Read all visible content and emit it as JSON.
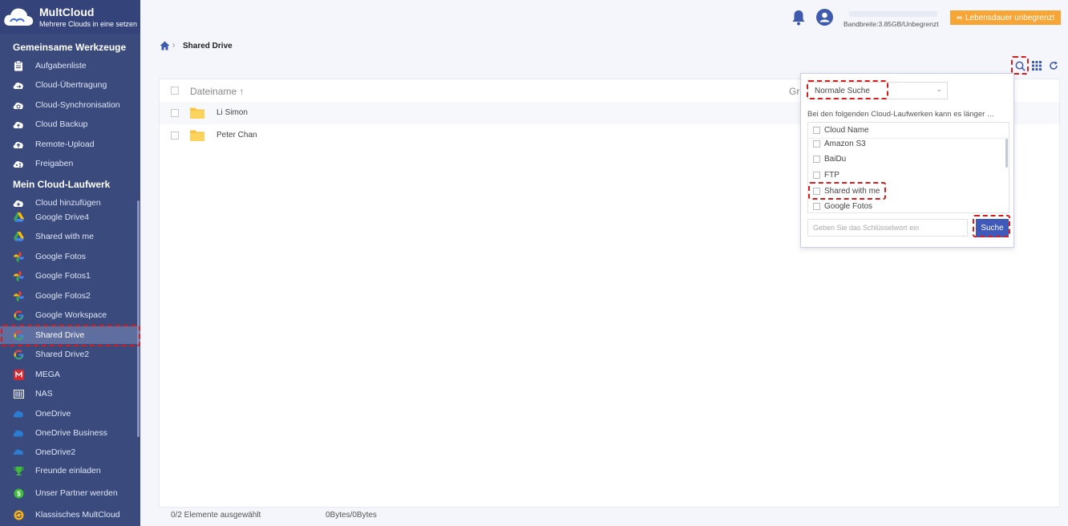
{
  "app": {
    "name": "MultCloud",
    "tagline": "Mehrere Clouds in eine setzen"
  },
  "sidebar": {
    "section_tools": "Gemeinsame Werkzeuge",
    "tools": [
      {
        "label": "Aufgabenliste",
        "icon": "clipboard-icon"
      },
      {
        "label": "Cloud-Übertragung",
        "icon": "cloud-transfer-icon"
      },
      {
        "label": "Cloud-Synchronisation",
        "icon": "cloud-sync-icon"
      },
      {
        "label": "Cloud Backup",
        "icon": "cloud-backup-icon"
      },
      {
        "label": "Remote-Upload",
        "icon": "cloud-upload-icon"
      },
      {
        "label": "Freigaben",
        "icon": "cloud-share-icon"
      }
    ],
    "section_drives": "Mein Cloud-Laufwerk",
    "add_cloud": "Cloud hinzufügen",
    "drives": [
      {
        "label": "Google Drive4",
        "icon": "google-drive-icon"
      },
      {
        "label": "Shared with me",
        "icon": "google-drive-icon"
      },
      {
        "label": "Google Fotos",
        "icon": "google-photos-icon"
      },
      {
        "label": "Google Fotos1",
        "icon": "google-photos-icon"
      },
      {
        "label": "Google Fotos2",
        "icon": "google-photos-icon"
      },
      {
        "label": "Google Workspace",
        "icon": "google-g-icon"
      },
      {
        "label": "Shared Drive",
        "icon": "google-g-icon"
      },
      {
        "label": "Shared Drive2",
        "icon": "google-g-icon"
      },
      {
        "label": "MEGA",
        "icon": "mega-icon"
      },
      {
        "label": "NAS",
        "icon": "nas-icon"
      },
      {
        "label": "OneDrive",
        "icon": "onedrive-icon"
      },
      {
        "label": "OneDrive Business",
        "icon": "onedrive-icon"
      },
      {
        "label": "OneDrive2",
        "icon": "onedrive-icon"
      }
    ],
    "bottom": [
      {
        "label": "Freunde einladen",
        "icon": "trophy-icon"
      },
      {
        "label": "Unser Partner werden",
        "icon": "dollar-icon"
      },
      {
        "label": "Klassisches MultCloud",
        "icon": "classic-icon"
      }
    ]
  },
  "header": {
    "bandwidth": "Bandbreite:3.85GB/Unbegrenzt",
    "upgrade": "Lebensdauer unbegrenzt",
    "upgrade_symbol": "∞"
  },
  "breadcrumb": {
    "separator": "›",
    "current": "Shared Drive"
  },
  "table": {
    "col_name": "Dateiname",
    "sort_arrow": "↑",
    "col_size": "Größe",
    "rows": [
      {
        "name": "Li Simon"
      },
      {
        "name": "Peter Chan"
      }
    ]
  },
  "footer": {
    "selected": "0/2 Elemente ausgewählt",
    "bytes": "0Bytes/0Bytes"
  },
  "search_popup": {
    "mode_selected": "Normale Suche",
    "chevron": "⌄",
    "hint": "Bei den folgenden Cloud-Laufwerken kann es länger …",
    "list_header": "Cloud Name",
    "clouds": [
      "Amazon S3",
      "BaiDu",
      "FTP",
      "Shared with me",
      "Google Fotos"
    ],
    "keyword_placeholder": "Geben Sie das Schlüsselwort ein",
    "search_button": "Suche"
  },
  "colors": {
    "sidebar_bg": "#3a4a7c",
    "active_item": "#5e6e9e",
    "accent_orange": "#f7a534",
    "primary_blue": "#3f5ab8",
    "highlight_red": "#d81b1b"
  }
}
